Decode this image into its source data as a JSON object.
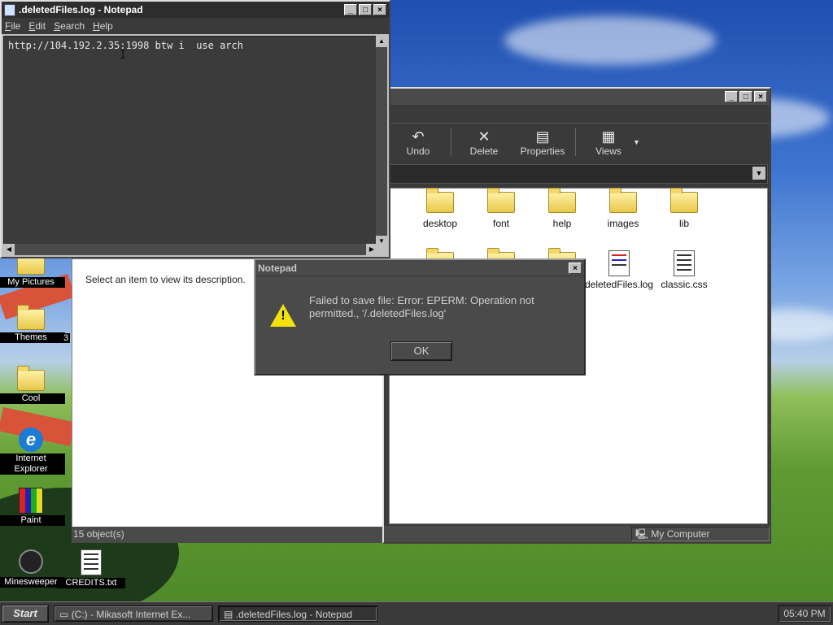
{
  "desktop": {
    "icons": [
      {
        "label": "My Pictures"
      },
      {
        "label": "Themes"
      },
      {
        "label": "Cool"
      },
      {
        "label": "Internet Explorer"
      },
      {
        "label": "Paint"
      },
      {
        "label": "Minesweeper"
      },
      {
        "label": "CREDITS.txt"
      }
    ],
    "partial_label": "3"
  },
  "notepad": {
    "title": ".deletedFiles.log - Notepad",
    "menu": [
      "File",
      "Edit",
      "Search",
      "Help"
    ],
    "content": "http://104.192.2.35:1998 btw i  use arch"
  },
  "explorer": {
    "toolbar": [
      {
        "label": "Undo",
        "icon": "undo-icon"
      },
      {
        "label": "Delete",
        "icon": "delete-icon"
      },
      {
        "label": "Properties",
        "icon": "properties-icon"
      },
      {
        "label": "Views",
        "icon": "views-icon"
      }
    ],
    "info_description": "Select an item to view its description.",
    "files": [
      {
        "name": "desktop",
        "kind": "folder"
      },
      {
        "name": "font",
        "kind": "folder"
      },
      {
        "name": "help",
        "kind": "folder"
      },
      {
        "name": "images",
        "kind": "folder"
      },
      {
        "name": "lib",
        "kind": "folder"
      },
      {
        "name": "deletedFiles.log",
        "kind": "log"
      },
      {
        "name": "classic.css",
        "kind": "doc"
      }
    ],
    "status_count": "15 object(s)",
    "status_location": "My Computer"
  },
  "dialog": {
    "title": "Notepad",
    "message": "Failed to save file: Error: EPERM: Operation not permitted., '/.deletedFiles.log'",
    "ok_label": "OK"
  },
  "taskbar": {
    "start_label": "Start",
    "items": [
      {
        "label": "(C:) - Mikasoft Internet Ex..."
      },
      {
        "label": ".deletedFiles.log - Notepad"
      }
    ],
    "clock": "05:40 PM"
  }
}
